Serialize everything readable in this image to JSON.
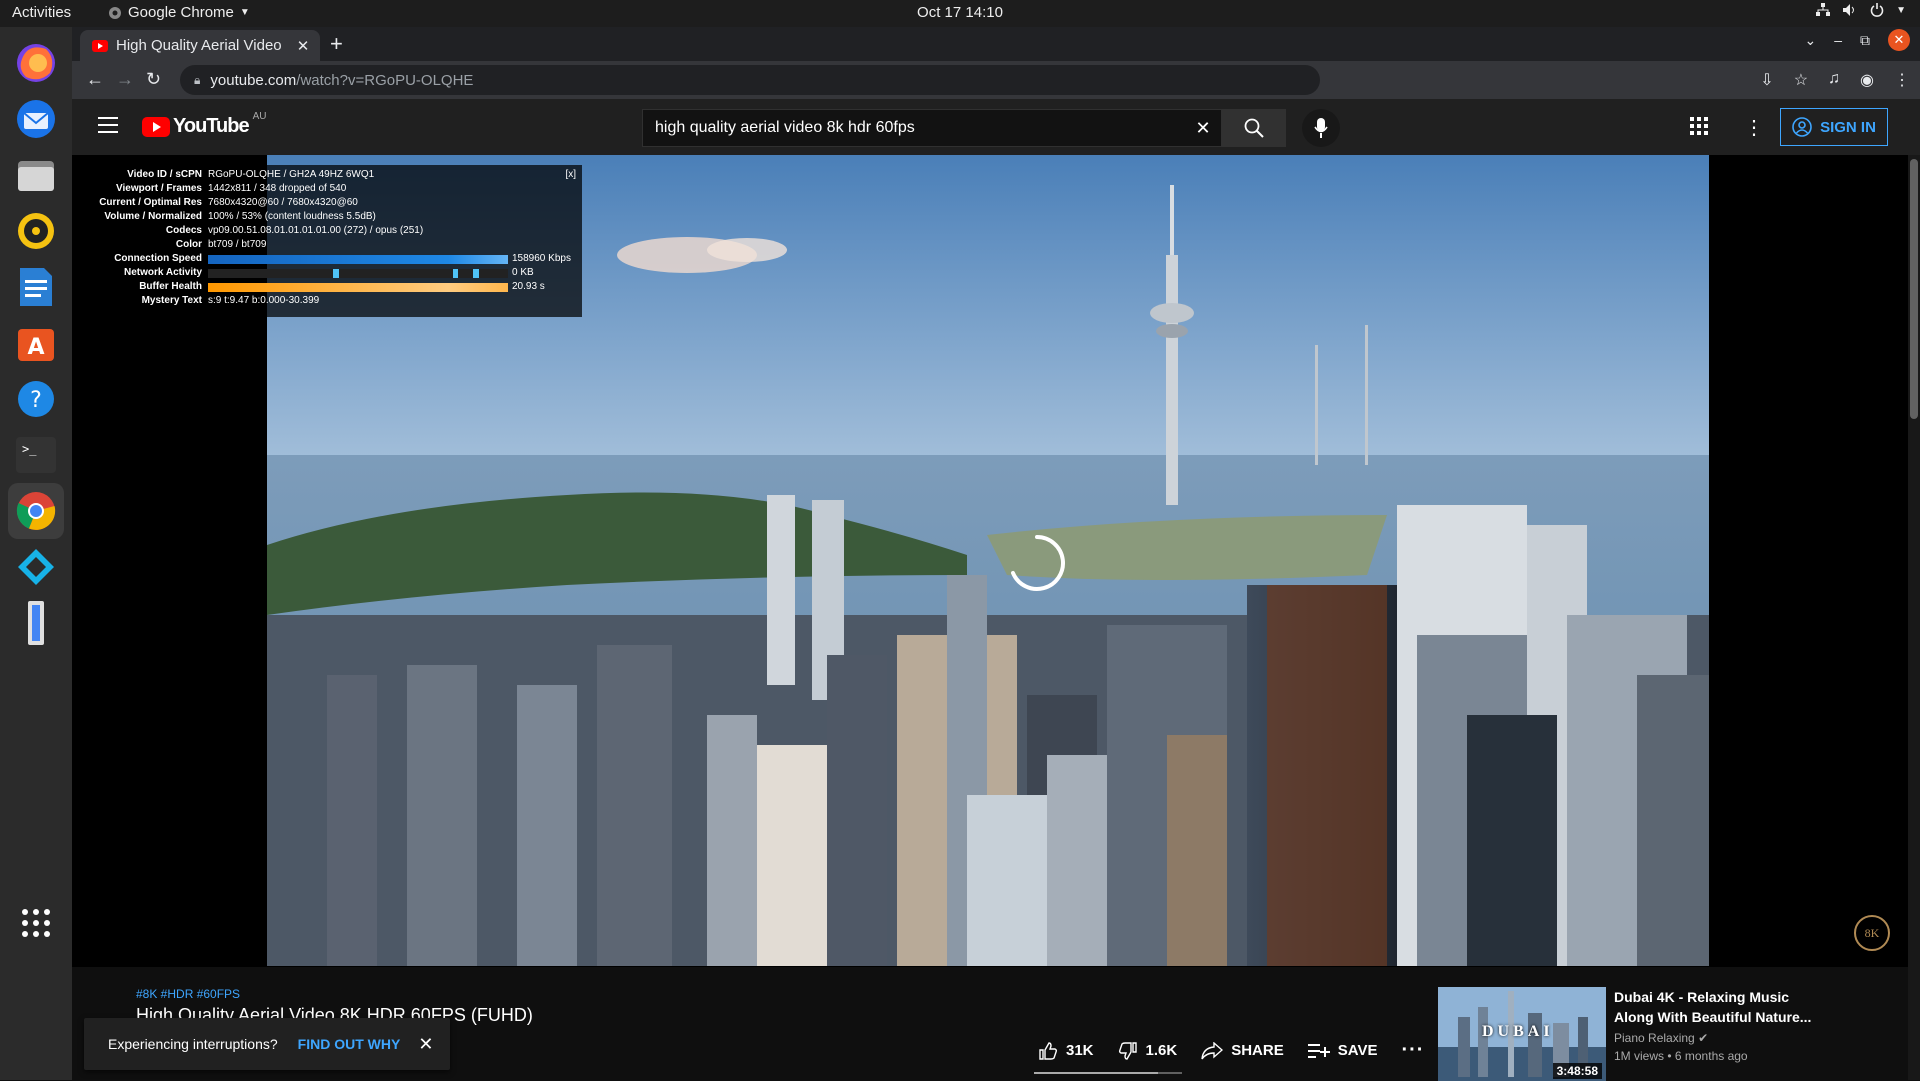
{
  "ubuntu": {
    "activities": "Activities",
    "app_name": "Google Chrome",
    "clock": "Oct 17  14:10"
  },
  "dock": {
    "items": [
      "Firefox",
      "Thunderbird",
      "Files",
      "Rhythmbox",
      "LibreOffice Writer",
      "Ubuntu Software",
      "Help",
      "Terminal",
      "Google Chrome",
      "Kodi",
      "Text Editor",
      "Show Applications"
    ]
  },
  "chrome": {
    "tab_title": "High Quality Aerial Video",
    "url_domain": "youtube.com",
    "url_path": "/watch?v=RGoPU-OLQHE"
  },
  "youtube": {
    "logo_text": "YouTube",
    "country_code": "AU",
    "search_value": "high quality aerial video 8k hdr 60fps",
    "signin_label": "SIGN IN",
    "accent": "#3ea6ff",
    "brand_red": "#ff0000"
  },
  "stats": {
    "rows": [
      {
        "k": "Video ID / sCPN",
        "v": "RGoPU-OLQHE / GH2A 49HZ 6WQ1"
      },
      {
        "k": "Viewport / Frames",
        "v": "1442x811 / 348 dropped of 540"
      },
      {
        "k": "Current / Optimal Res",
        "v": "7680x4320@60 / 7680x4320@60"
      },
      {
        "k": "Volume / Normalized",
        "v": "100% / 53% (content loudness 5.5dB)"
      },
      {
        "k": "Codecs",
        "v": "vp09.00.51.08.01.01.01.01.00 (272) / opus (251)"
      },
      {
        "k": "Color",
        "v": "bt709 / bt709"
      },
      {
        "k": "Connection Speed",
        "v": "158960 Kbps"
      },
      {
        "k": "Network Activity",
        "v": "0 KB"
      },
      {
        "k": "Buffer Health",
        "v": "20.93 s"
      },
      {
        "k": "Mystery Text",
        "v": "s:9 t:9.47 b:0.000-30.399"
      }
    ],
    "close_label": "[x]"
  },
  "video": {
    "watermark": "8K"
  },
  "below": {
    "tags": "#8K #HDR #60FPS",
    "title": "High Quality Aerial Video 8K HDR 60FPS (FUHD)",
    "toast_msg": "Experiencing interruptions?",
    "toast_link": "FIND OUT WHY",
    "likes": "31K",
    "dislikes": "1.6K",
    "share": "SHARE",
    "save": "SAVE",
    "like_ratio": 0.84
  },
  "recommended": {
    "title_line1": "Dubai 4K - Relaxing Music",
    "title_line2": "Along With Beautiful Nature...",
    "channel": "Piano Relaxing",
    "views": "1M views • 6 months ago",
    "duration": "3:48:58",
    "thumb_text": "DUBAI"
  }
}
